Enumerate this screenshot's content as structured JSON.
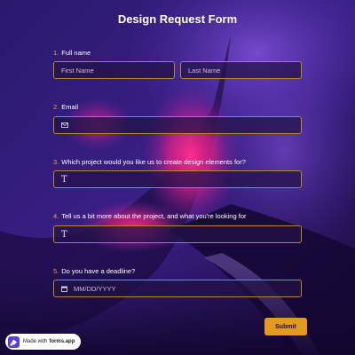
{
  "form": {
    "title": "Design Request Form",
    "questions": [
      {
        "number": "1.",
        "label": "Full name",
        "fields": [
          {
            "placeholder": "First Name"
          },
          {
            "placeholder": "Last Name"
          }
        ]
      },
      {
        "number": "2.",
        "label": "Email",
        "icon": "envelope-icon"
      },
      {
        "number": "3.",
        "label": "Which project would you like us to create design elements for?",
        "icon": "text-t-icon",
        "icon_text": "T"
      },
      {
        "number": "4.",
        "label": "Tell us a bit more about the project, and what you're looking for",
        "icon": "text-t-icon",
        "icon_text": "T"
      },
      {
        "number": "5.",
        "label": "Do you have a deadline?",
        "icon": "calendar-icon",
        "placeholder": "MM/DD/YYYY"
      }
    ],
    "submit_label": "Submit"
  },
  "badge": {
    "prefix": "Made with",
    "brand": "forms.app"
  },
  "colors": {
    "accent": "#e29a1f",
    "number": "#e9a23b",
    "field_border": "#b8862f",
    "background": "#1e0f4a",
    "highlight": "#ff2d8c"
  }
}
